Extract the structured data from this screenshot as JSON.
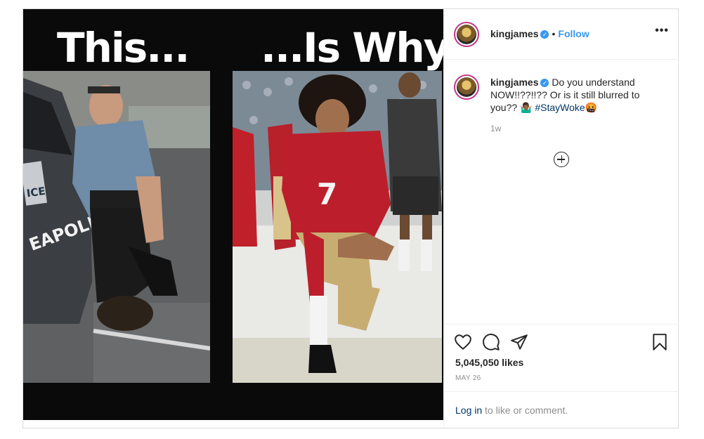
{
  "post": {
    "image": {
      "left_caption": "This...",
      "right_caption": "...Is Why.",
      "left_photo_text": "EAPOLIS",
      "left_plate_text": "ICE",
      "jersey_number": "7"
    },
    "header": {
      "username": "kingjames",
      "verified": "✓",
      "separator": "•",
      "follow_label": "Follow",
      "more_label": "•••"
    },
    "caption": {
      "username": "kingjames",
      "verified": "✓",
      "text": "Do you understand NOW!!??!!?? Or is it still blurred to you?? 🤷🏾‍♂️",
      "hashtag": "#StayWoke🤬",
      "time": "1w"
    },
    "actions": {
      "likes": "5,045,050 likes",
      "date": "MAY 26"
    },
    "login": {
      "link": "Log in",
      "text": " to like or comment."
    }
  },
  "icons": [
    "heart-icon",
    "comment-icon",
    "share-icon",
    "bookmark-icon",
    "plus-circle-icon",
    "more-options-icon",
    "verified-badge-icon"
  ],
  "colors": {
    "accent": "#3897f0",
    "text": "#262626",
    "muted": "#8e8e8e",
    "border": "#dbdbdb",
    "story_ring": "#c13584"
  }
}
